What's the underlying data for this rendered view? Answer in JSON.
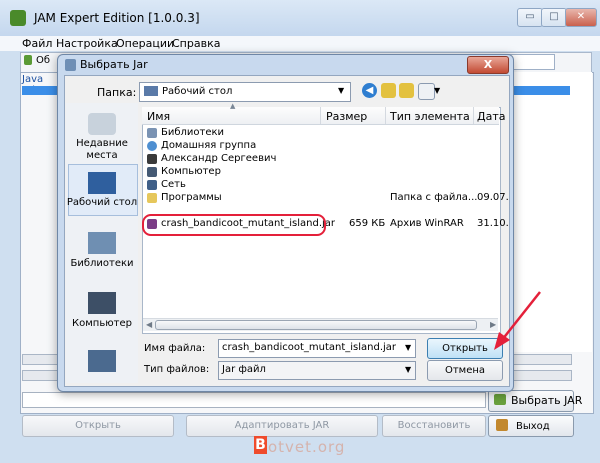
{
  "app": {
    "title": "JAM Expert Edition [1.0.0.3]",
    "window_controls": {
      "minimize": "▭",
      "maximize": "□",
      "close": "✕"
    },
    "menu": [
      "Файл",
      "Настройка",
      "Операции",
      "Справка"
    ],
    "tabs": {
      "first": "Об"
    },
    "list_header": "Java Ad",
    "buttons": {
      "pick_jar": "Выбрать JAR",
      "open": "Открыть",
      "adapt": "Адаптировать JAR",
      "restore": "Восстановить",
      "exit": "Выход"
    }
  },
  "dialog": {
    "title": "Выбрать Jar",
    "close": "X",
    "folder_label": "Папка:",
    "folder_value": "Рабочий стол",
    "places": [
      {
        "label": "Недавние места",
        "icon": "recent-places-icon"
      },
      {
        "label": "Рабочий стол",
        "icon": "desktop-icon"
      },
      {
        "label": "Библиотеки",
        "icon": "libraries-icon"
      },
      {
        "label": "Компьютер",
        "icon": "computer-icon"
      },
      {
        "label": "",
        "icon": "network-icon"
      }
    ],
    "columns": [
      "Имя",
      "Размер",
      "Тип элемента",
      "Дата"
    ],
    "files": [
      {
        "name": "Библиотеки",
        "size": "",
        "type": "",
        "date": "",
        "icon": "libraries-icon"
      },
      {
        "name": "Домашняя группа",
        "size": "",
        "type": "",
        "date": "",
        "icon": "homegroup-icon"
      },
      {
        "name": "Александр Сергеевич",
        "size": "",
        "type": "",
        "date": "",
        "icon": "user-folder-icon"
      },
      {
        "name": "Компьютер",
        "size": "",
        "type": "",
        "date": "",
        "icon": "computer-icon"
      },
      {
        "name": "Сеть",
        "size": "",
        "type": "",
        "date": "",
        "icon": "network-icon"
      },
      {
        "name": "Программы",
        "size": "",
        "type": "Папка с файла...",
        "date": "09.07.",
        "icon": "folder-icon"
      },
      {
        "name": "crash_bandicoot_mutant_island.jar",
        "size": "659 КБ",
        "type": "Архив WinRAR",
        "date": "31.10.",
        "icon": "winrar-icon"
      }
    ],
    "file_name_label": "Имя файла:",
    "file_name_value": "crash_bandicoot_mutant_island.jar",
    "file_type_label": "Тип файлов:",
    "file_type_value": "Jar файл",
    "open_button": "Открыть",
    "cancel_button": "Отмена"
  },
  "watermark": {
    "box": "B",
    "text": "otvet.org"
  },
  "colors": {
    "accent": "#3b8ee8",
    "highlight_ring": "#e4203a",
    "title_gradient": "#c8d9ee"
  }
}
